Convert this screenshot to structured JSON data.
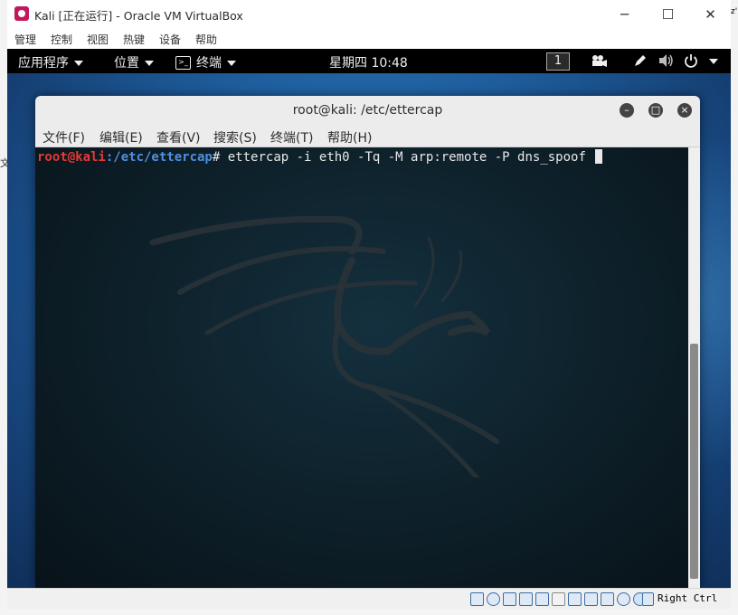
{
  "vbox": {
    "title": "Kali [正在运行] - Oracle VM VirtualBox",
    "menu": [
      "管理",
      "控制",
      "视图",
      "热键",
      "设备",
      "帮助"
    ],
    "controls": {
      "minimize": "─",
      "maximize": "☐",
      "close": "✕"
    },
    "host_key": "Right Ctrl"
  },
  "guest": {
    "topbar": {
      "apps": "应用程序",
      "places": "位置",
      "terminal": "终端",
      "clock": "星期四 10:48",
      "workspace": "1"
    },
    "terminal": {
      "title": "root@kali: /etc/ettercap",
      "menu": [
        "文件(F)",
        "编辑(E)",
        "查看(V)",
        "搜索(S)",
        "终端(T)",
        "帮助(H)"
      ],
      "prompt_user": "root@kali",
      "prompt_path": ":/etc/ettercap",
      "prompt_symbol": "#",
      "command": " ettercap -i eth0 -Tq -M arp:remote -P dns_spoof "
    }
  },
  "host": {
    "left_fragment": "文",
    "right_fragment": "z'"
  },
  "colors": {
    "prompt_user": "#e53935",
    "prompt_path": "#4f8fe0",
    "terminal_bg": "#0b1a22",
    "desktop_blue": "#1f5f9f"
  }
}
